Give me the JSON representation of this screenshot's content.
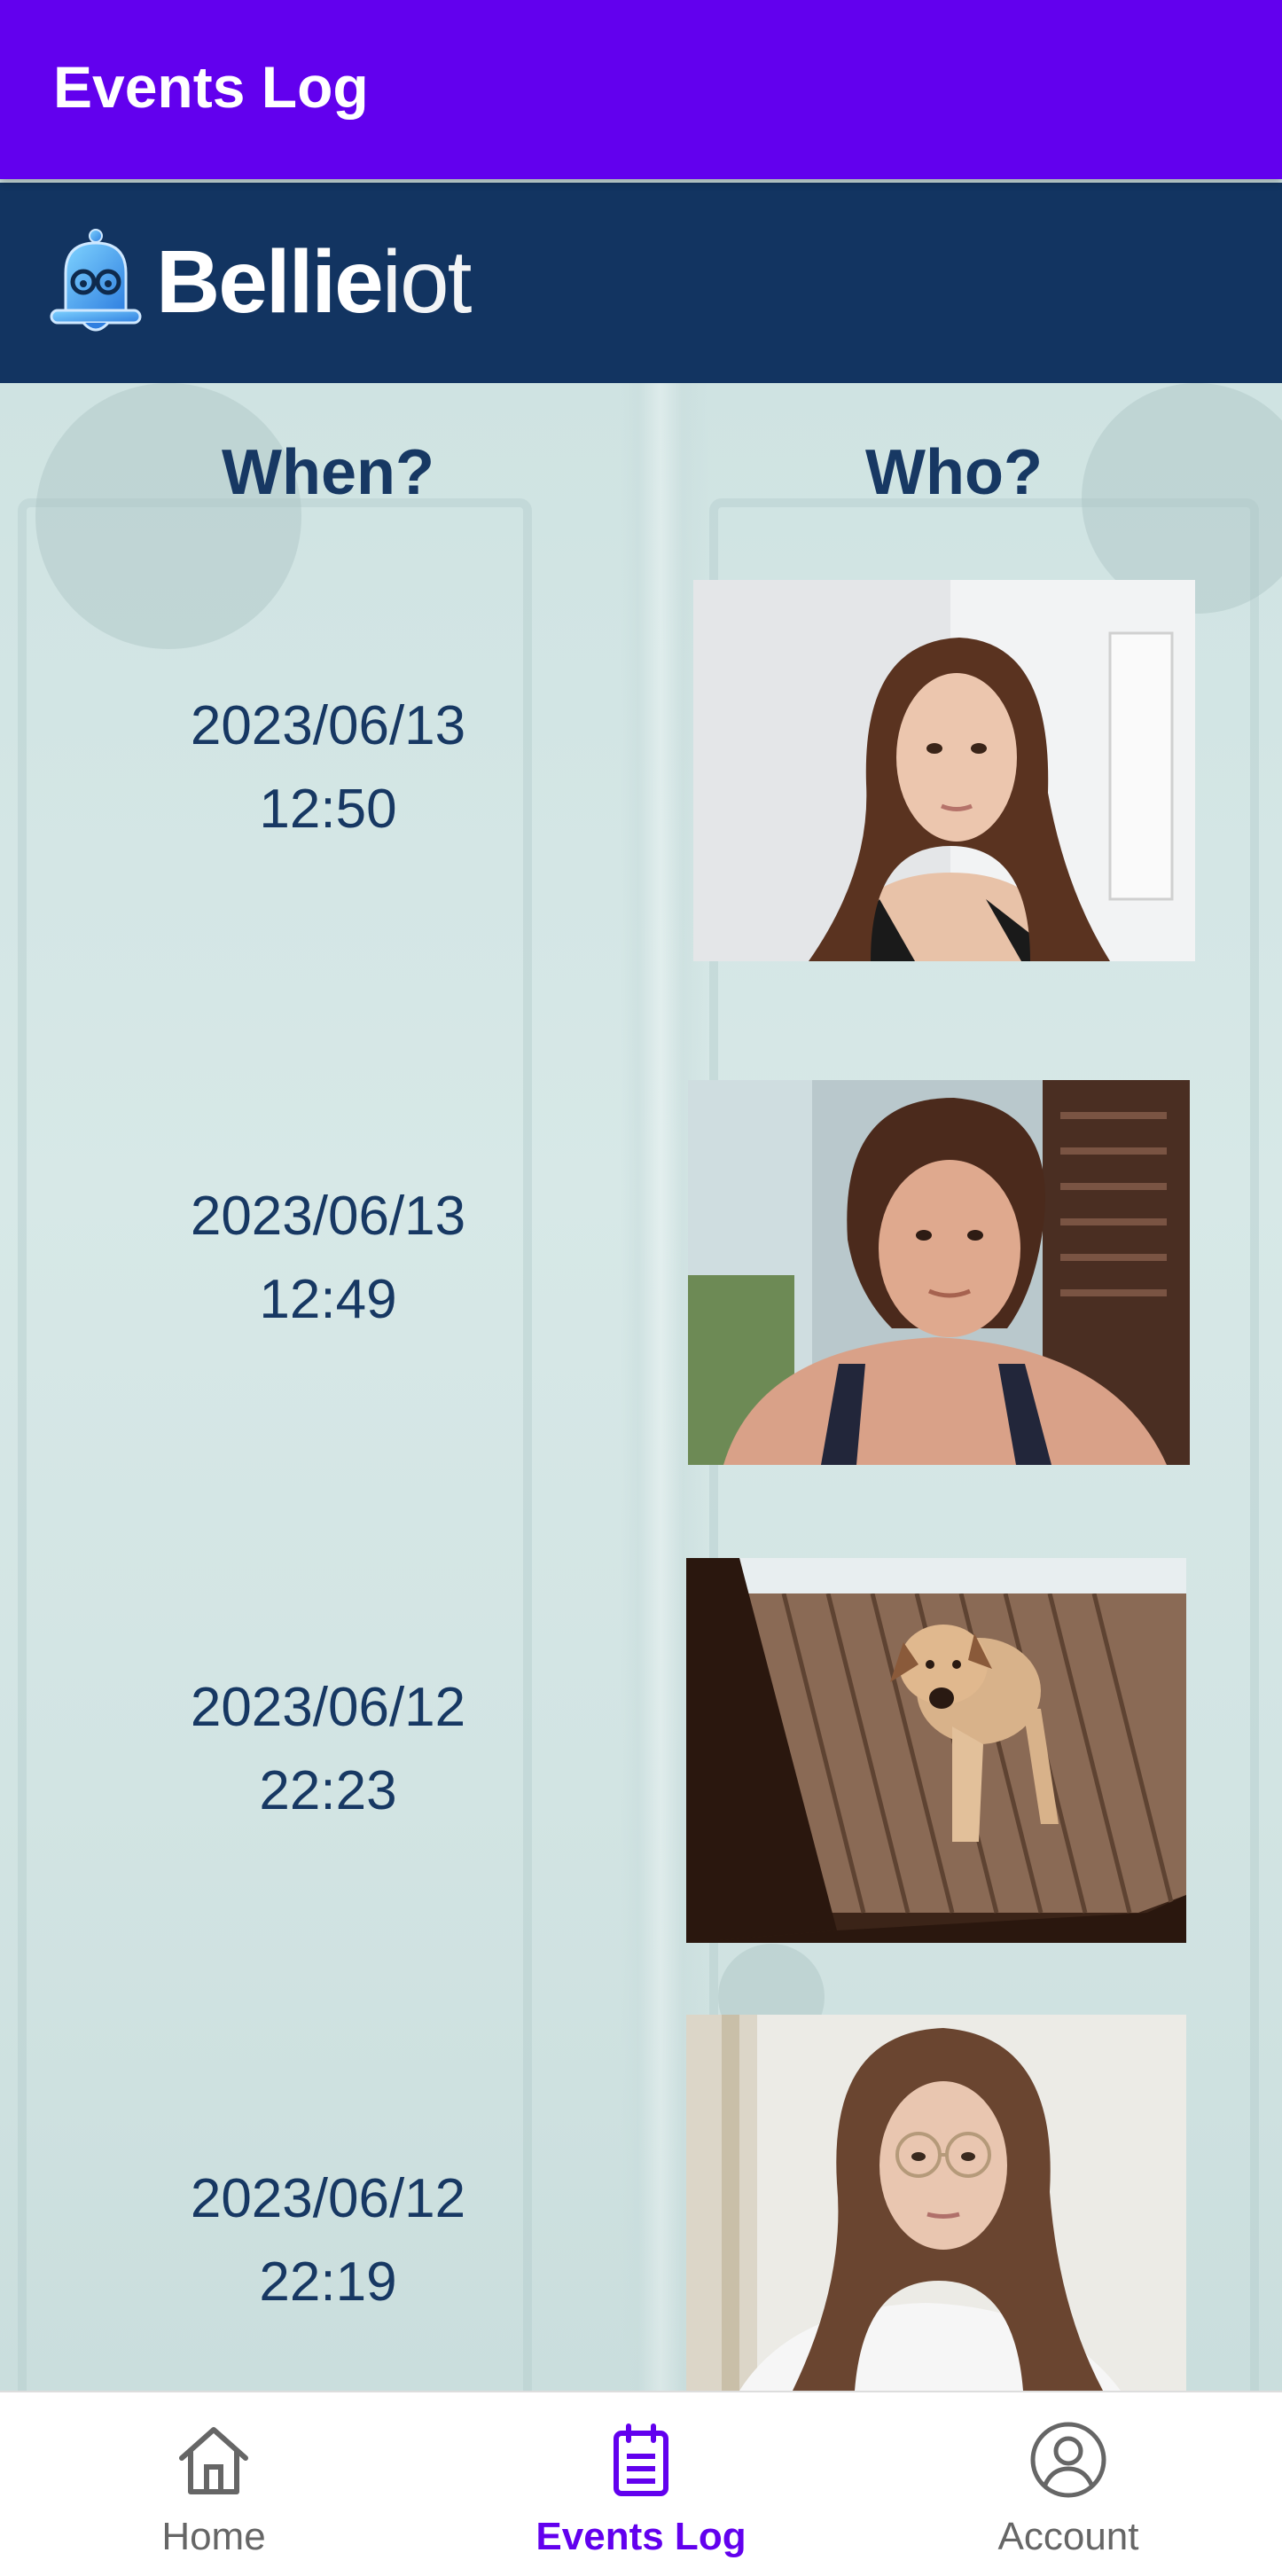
{
  "appbar": {
    "title": "Events Log"
  },
  "brand": {
    "name_bold": "Bellie",
    "name_light": "iot",
    "icon": "bell-with-glasses-icon"
  },
  "table": {
    "when_header": "When?",
    "who_header": "Who?",
    "events": [
      {
        "date": "2023/06/13",
        "time": "12:50",
        "photo": "person-photo"
      },
      {
        "date": "2023/06/13",
        "time": "12:49",
        "photo": "person-photo"
      },
      {
        "date": "2023/06/12",
        "time": "22:23",
        "photo": "dog-photo"
      },
      {
        "date": "2023/06/12",
        "time": "22:19",
        "photo": "person-photo"
      }
    ]
  },
  "nav": {
    "items": [
      {
        "label": "Home",
        "icon": "home-icon"
      },
      {
        "label": "Events Log",
        "icon": "clipboard-icon",
        "active": true
      },
      {
        "label": "Account",
        "icon": "account-circle-icon"
      }
    ]
  },
  "colors": {
    "appbar": "#6200ee",
    "brandbar": "#123461",
    "text_dark": "#173863",
    "nav_active": "#6200ee"
  }
}
